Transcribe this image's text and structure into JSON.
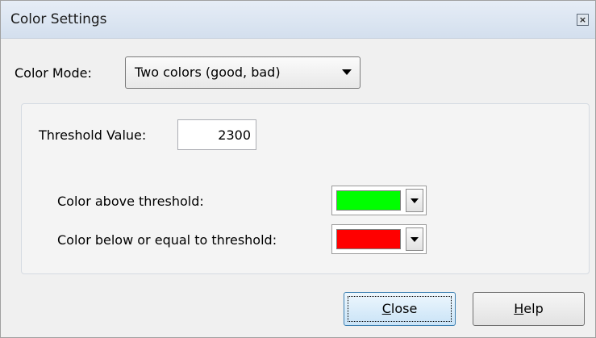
{
  "window": {
    "title": "Color Settings"
  },
  "color_mode": {
    "label": "Color Mode:",
    "selected": "Two colors (good, bad)"
  },
  "threshold": {
    "label": "Threshold Value:",
    "value": "2300"
  },
  "above": {
    "label": "Color above threshold:",
    "color": "#00ff00"
  },
  "below": {
    "label": "Color below or equal to threshold:",
    "color": "#ff0000"
  },
  "buttons": {
    "close": {
      "mnemonic": "C",
      "rest": "lose"
    },
    "help": {
      "mnemonic": "H",
      "rest": "elp"
    }
  }
}
